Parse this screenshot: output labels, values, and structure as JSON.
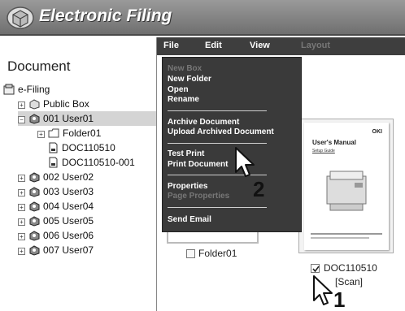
{
  "app": {
    "title": "Electronic Filing",
    "logo_icon": "box-logo-icon"
  },
  "sidebar": {
    "heading": "Document",
    "tree": [
      {
        "label": "e-Filing",
        "icon": "efiling-root-icon"
      },
      {
        "label": "Public Box",
        "icon": "box-icon",
        "expander": "+"
      },
      {
        "label": "001 User01",
        "icon": "user-box-icon",
        "expander": "−",
        "selected": true
      },
      {
        "label": "Folder01",
        "icon": "folder-icon",
        "expander": "+"
      },
      {
        "label": "DOC110510",
        "icon": "document-icon"
      },
      {
        "label": "DOC110510-001",
        "icon": "document-icon"
      },
      {
        "label": "002 User02",
        "icon": "user-box-icon",
        "expander": "+"
      },
      {
        "label": "003 User03",
        "icon": "user-box-icon",
        "expander": "+"
      },
      {
        "label": "004 User04",
        "icon": "user-box-icon",
        "expander": "+"
      },
      {
        "label": "005 User05",
        "icon": "user-box-icon",
        "expander": "+"
      },
      {
        "label": "006 User06",
        "icon": "user-box-icon",
        "expander": "+"
      },
      {
        "label": "007 User07",
        "icon": "user-box-icon",
        "expander": "+"
      }
    ]
  },
  "menubar": {
    "file": "File",
    "edit": "Edit",
    "view": "View",
    "layout": "Layout"
  },
  "file_menu": {
    "new_box": "New Box",
    "new_folder": "New Folder",
    "open": "Open",
    "rename": "Rename",
    "archive_document": "Archive Document",
    "upload_archived_document": "Upload Archived Document",
    "test_print": "Test Print",
    "print_document": "Print Document",
    "properties": "Properties",
    "page_properties": "Page Properties",
    "send_email": "Send Email"
  },
  "content": {
    "folder_item": {
      "label": "Folder01",
      "checked": false
    },
    "document_item": {
      "label": "DOC110510",
      "sublabel": "[Scan]",
      "checked": true,
      "thumb_brand": "OKI",
      "thumb_title": "User's Manual",
      "thumb_subtitle": "Setup Guide"
    }
  },
  "annotations": {
    "step1": "1",
    "step2": "2"
  }
}
